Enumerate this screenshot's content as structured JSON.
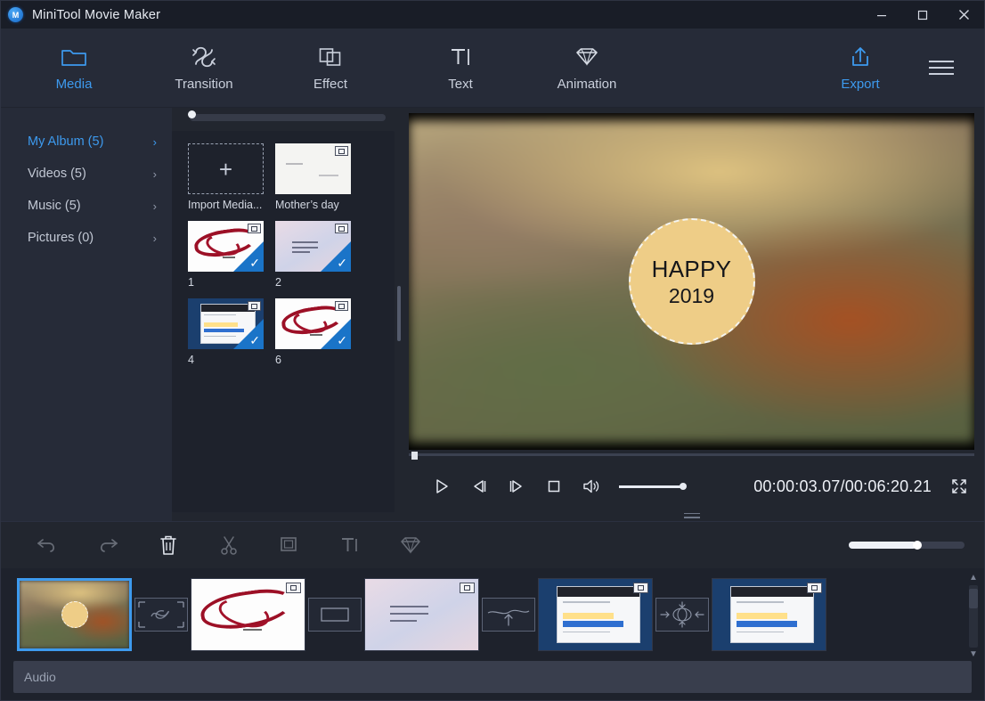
{
  "window": {
    "title": "MiniTool Movie Maker",
    "logo_letter": "M",
    "minimize_icon": "minimize-icon",
    "maximize_icon": "maximize-icon",
    "close_icon": "close-icon"
  },
  "ribbon": {
    "items": [
      {
        "id": "media",
        "label": "Media",
        "icon": "folder-icon",
        "active": true
      },
      {
        "id": "transition",
        "label": "Transition",
        "icon": "transition-icon",
        "active": false
      },
      {
        "id": "effect",
        "label": "Effect",
        "icon": "effect-icon",
        "active": false
      },
      {
        "id": "text",
        "label": "Text",
        "icon": "text-icon",
        "active": false
      },
      {
        "id": "animation",
        "label": "Animation",
        "icon": "diamond-icon",
        "active": false
      },
      {
        "id": "export",
        "label": "Export",
        "icon": "export-icon",
        "active": true
      }
    ],
    "menu_icon": "hamburger-menu-icon",
    "accent_color": "#3d9aee"
  },
  "sidebar": {
    "items": [
      {
        "label": "My Album (5)",
        "active": true,
        "chevron": "›"
      },
      {
        "label": "Videos (5)",
        "active": false,
        "chevron": "›"
      },
      {
        "label": "Music (5)",
        "active": false,
        "chevron": "›"
      },
      {
        "label": "Pictures (0)",
        "active": false,
        "chevron": "›"
      }
    ]
  },
  "media_panel": {
    "size_slider_value": 5,
    "items": [
      {
        "label": "Import Media...",
        "kind": "import",
        "art": "none",
        "selected": false,
        "video_badge": false
      },
      {
        "label": "Mother’s day",
        "kind": "media",
        "art": "note",
        "selected": false,
        "video_badge": true
      },
      {
        "label": "1",
        "kind": "media",
        "art": "love",
        "selected": true,
        "video_badge": true
      },
      {
        "label": "2",
        "kind": "media",
        "art": "pink",
        "selected": true,
        "video_badge": true
      },
      {
        "label": "4",
        "kind": "media",
        "art": "win",
        "selected": true,
        "video_badge": true
      },
      {
        "label": "6",
        "kind": "media",
        "art": "love",
        "selected": true,
        "video_badge": true
      }
    ]
  },
  "preview": {
    "overlay_line1": "HAPPY",
    "overlay_line2": "2019",
    "bubble_color": "#eecd87",
    "seek_position_pct": 0.8,
    "controls": {
      "play": "play-icon",
      "prev_frame": "previous-frame-icon",
      "next_frame": "next-frame-icon",
      "stop": "stop-icon",
      "volume": "volume-icon",
      "fullscreen": "fullscreen-icon",
      "volume_level_pct": 95
    },
    "timecode": "00:00:03.07/00:06:20.21",
    "current_time": "00:00:03.07",
    "total_time": "00:06:20.21"
  },
  "edit_toolbar": {
    "buttons": [
      {
        "name": "undo-button",
        "icon": "undo-icon",
        "enabled": false
      },
      {
        "name": "redo-button",
        "icon": "redo-icon",
        "enabled": false
      },
      {
        "name": "delete-button",
        "icon": "trash-icon",
        "enabled": true
      },
      {
        "name": "split-button",
        "icon": "scissors-icon",
        "enabled": false
      },
      {
        "name": "crop-button",
        "icon": "crop-icon",
        "enabled": false
      },
      {
        "name": "text-button",
        "icon": "text-icon",
        "enabled": false
      },
      {
        "name": "animation-button",
        "icon": "diamond-icon",
        "enabled": false
      }
    ],
    "zoom_slider_pct": 56
  },
  "timeline": {
    "audio_track_label": "Audio",
    "clips": [
      {
        "index": 1,
        "art": "preview",
        "selected": true,
        "video_badge": false
      },
      {
        "index": 2,
        "art": "love",
        "selected": false,
        "video_badge": true
      },
      {
        "index": 3,
        "art": "pink",
        "selected": false,
        "video_badge": true
      },
      {
        "index": 4,
        "art": "win",
        "selected": false,
        "video_badge": true
      },
      {
        "index": 5,
        "art": "win",
        "selected": false,
        "video_badge": true
      }
    ],
    "transitions": [
      {
        "icon": "transition-dissolve-icon"
      },
      {
        "icon": "transition-rectangle-icon"
      },
      {
        "icon": "transition-arrow-up-icon"
      },
      {
        "icon": "transition-converge-icon"
      }
    ],
    "scroll_up_icon": "chevron-up-icon",
    "scroll_down_icon": "chevron-down-icon"
  }
}
